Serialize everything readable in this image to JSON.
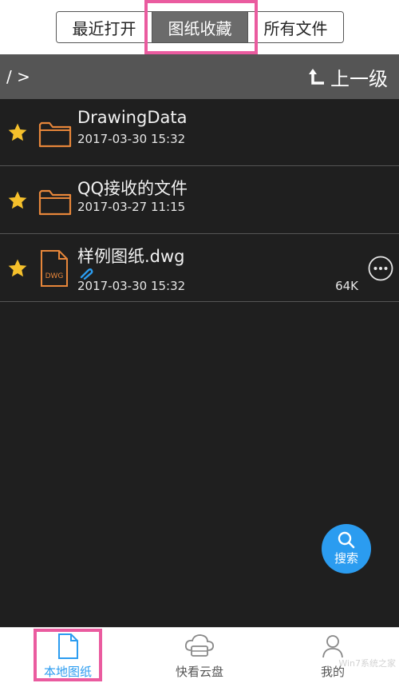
{
  "tabs": [
    {
      "label": "最近打开",
      "active": false
    },
    {
      "label": "图纸收藏",
      "active": true
    },
    {
      "label": "所有文件",
      "active": false
    }
  ],
  "path": "/ >",
  "up_label": "上一级",
  "files": [
    {
      "name": "DrawingData",
      "date": "2017-03-30 15:32",
      "type": "folder",
      "starred": true,
      "icon": "folder-icon"
    },
    {
      "name": "QQ接收的文件",
      "date": "2017-03-27 11:15",
      "type": "folder",
      "starred": true,
      "icon": "folder-icon"
    },
    {
      "name": "样例图纸.dwg",
      "date": "2017-03-30 15:32",
      "type": "dwg",
      "size": "64K",
      "starred": true,
      "icon": "dwg-file-icon",
      "file_badge": "DWG"
    }
  ],
  "search_label": "搜索",
  "bottom_nav": [
    {
      "label": "本地图纸",
      "icon": "document-icon",
      "active": true
    },
    {
      "label": "快看云盘",
      "icon": "cloud-drive-icon",
      "active": false
    },
    {
      "label": "我的",
      "icon": "user-icon",
      "active": false
    }
  ],
  "watermark": "Win7系统之家",
  "colors": {
    "accent": "#2b9cf0",
    "highlight": "#ea5b9f",
    "star": "#f5c02b",
    "folder": "#e7863a",
    "list_bg": "#1f1f1f",
    "pathbar_bg": "#555555"
  }
}
